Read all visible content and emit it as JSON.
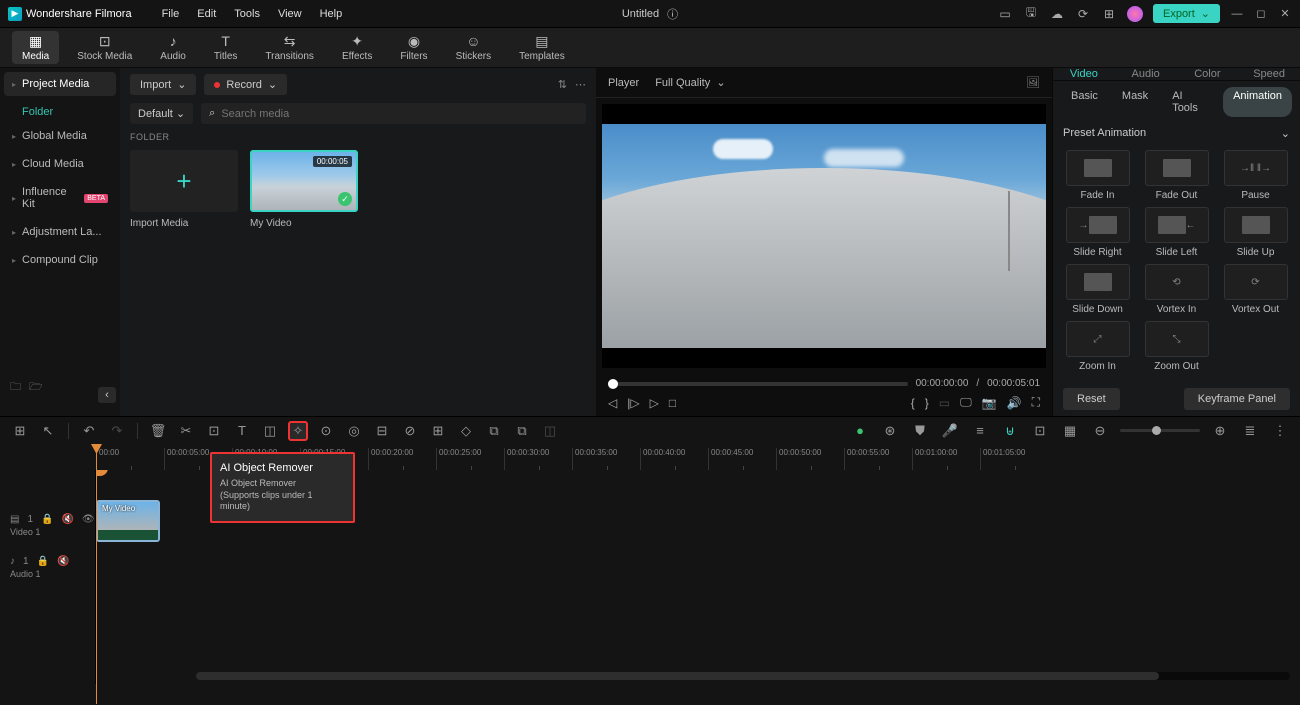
{
  "app": {
    "name": "Wondershare Filmora",
    "doc": "Untitled"
  },
  "menubar": [
    "File",
    "Edit",
    "Tools",
    "View",
    "Help"
  ],
  "export_label": "Export",
  "ribbon": [
    {
      "label": "Media",
      "active": true
    },
    {
      "label": "Stock Media"
    },
    {
      "label": "Audio"
    },
    {
      "label": "Titles"
    },
    {
      "label": "Transitions"
    },
    {
      "label": "Effects"
    },
    {
      "label": "Filters"
    },
    {
      "label": "Stickers"
    },
    {
      "label": "Templates"
    }
  ],
  "sidebar": {
    "items": [
      {
        "label": "Project Media",
        "sel": true
      },
      {
        "label": "Global Media"
      },
      {
        "label": "Cloud Media"
      },
      {
        "label": "Influence Kit",
        "beta": true
      },
      {
        "label": "Adjustment La..."
      },
      {
        "label": "Compound Clip"
      }
    ],
    "sub": "Folder"
  },
  "media": {
    "import": "Import",
    "record": "Record",
    "default": "Default",
    "search_placeholder": "Search media",
    "folder_label": "FOLDER",
    "thumbs": [
      {
        "label": "Import Media",
        "type": "add"
      },
      {
        "label": "My Video",
        "type": "video",
        "dur": "00:00:05"
      }
    ]
  },
  "player": {
    "tab": "Player",
    "quality": "Full Quality",
    "cur": "00:00:00:00",
    "sep": "/",
    "total": "00:00:05:01"
  },
  "inspector": {
    "tabs": [
      "Video",
      "Audio",
      "Color",
      "Speed"
    ],
    "active": 0,
    "subtabs": [
      "Basic",
      "Mask",
      "AI Tools",
      "Animation"
    ],
    "sub_active": 3,
    "section": "Preset Animation",
    "anims": [
      "Fade In",
      "Fade Out",
      "Pause",
      "Slide Right",
      "Slide Left",
      "Slide Up",
      "Slide Down",
      "Vortex In",
      "Vortex Out",
      "Zoom In",
      "Zoom Out"
    ],
    "reset": "Reset",
    "kfpanel": "Keyframe Panel"
  },
  "tooltip": {
    "title": "AI Object Remover",
    "line1": "AI Object Remover",
    "line2": "(Supports clips under 1 minute)"
  },
  "timeline": {
    "ruler": [
      "00:00",
      "00:00:05:00",
      "00:00:10:00",
      "00:00:15:00",
      "00:00:20:00",
      "00:00:25:00",
      "00:00:30:00",
      "00:00:35:00",
      "00:00:40:00",
      "00:00:45:00",
      "00:00:50:00",
      "00:00:55:00",
      "00:01:00:00",
      "00:01:05:00"
    ],
    "video_track": "Video 1",
    "audio_track": "Audio 1",
    "clip_name": "My Video"
  }
}
